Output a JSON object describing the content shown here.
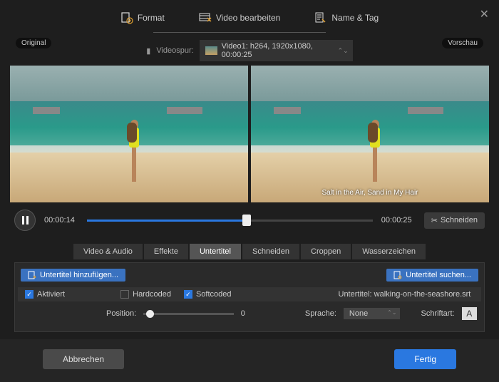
{
  "topTabs": {
    "format": "Format",
    "edit": "Video bearbeiten",
    "nameTag": "Name & Tag"
  },
  "track": {
    "label": "Videospur:",
    "value": "Video1: h264, 1920x1080, 00:00:25"
  },
  "labels": {
    "original": "Original",
    "preview": "Vorschau"
  },
  "subtitleOverlay": "Salt in the Air, Sand in My Hair",
  "timeline": {
    "current": "00:00:14",
    "total": "00:00:25",
    "cut": "Schneiden"
  },
  "editTabs": [
    "Video & Audio",
    "Effekte",
    "Untertitel",
    "Schneiden",
    "Croppen",
    "Wasserzeichen"
  ],
  "subtitlePanel": {
    "addBtn": "Untertitel hinzufügen...",
    "searchBtn": "Untertitel suchen...",
    "activated": "Aktiviert",
    "hardcoded": "Hardcoded",
    "softcoded": "Softcoded",
    "fileLabel": "Untertitel:",
    "fileName": "walking-on-the-seashore.srt",
    "position": "Position:",
    "positionVal": "0",
    "language": "Sprache:",
    "languageVal": "None",
    "font": "Schriftart:",
    "fontGlyph": "A"
  },
  "footer": {
    "cancel": "Abbrechen",
    "done": "Fertig"
  }
}
